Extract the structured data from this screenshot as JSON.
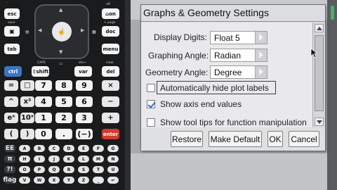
{
  "keypad": {
    "top_keys": {
      "esc": "esc",
      "on": "on",
      "tab": "tab",
      "doc": "doc",
      "menu": "menu",
      "save": "save",
      "home": "+ page",
      "off": "off",
      "up": "▲"
    },
    "row_ctrl": {
      "ctrl": "ctrl",
      "shift": "⇧shift",
      "var": "var",
      "del": "del",
      "caps": "CAPS",
      "sto": "sto→",
      "clear": "clear"
    },
    "num_rows": [
      [
        "=",
        "□",
        "7",
        "8",
        "9",
        "×"
      ],
      [
        "^",
        "x²",
        "4",
        "5",
        "6",
        "−"
      ],
      [
        "eˣ",
        "10ˣ",
        "1",
        "2",
        "3",
        "+"
      ],
      [
        "(",
        ")",
        "0",
        ".",
        "(−)",
        "enter"
      ]
    ],
    "letter_rows": [
      [
        "EE",
        "A",
        "B",
        "C",
        "D",
        "E",
        "F",
        "G"
      ],
      [
        "π",
        "H",
        "I",
        "J",
        "K",
        "L",
        "M",
        "N"
      ],
      [
        "?!",
        "O",
        "P",
        "Q",
        "R",
        "S",
        "T",
        "U"
      ],
      [
        "flag",
        "V",
        "W",
        "X",
        "Y",
        "Z",
        "_",
        "↵"
      ]
    ]
  },
  "dialog": {
    "title": "Graphs & Geometry Settings",
    "rows": [
      {
        "label": "Display Digits:",
        "value": "Float 5"
      },
      {
        "label": "Graphing Angle:",
        "value": "Radian"
      },
      {
        "label": "Geometry Angle:",
        "value": "Degree"
      }
    ],
    "checkboxes": [
      {
        "label": "Automatically hide plot labels",
        "checked": false
      },
      {
        "label": "Show axis end values",
        "checked": true
      },
      {
        "label": "Show tool tips for function manipulation",
        "checked": false
      }
    ],
    "buttons": {
      "restore": "Restore",
      "make_default": "Make Default",
      "ok": "OK",
      "cancel": "Cancel"
    }
  },
  "colors": {
    "ctrl_key": "#3b76c6",
    "enter_key": "#d43a2e",
    "check_mark": "#2f6fd2",
    "status_green": "#4fae6a"
  }
}
